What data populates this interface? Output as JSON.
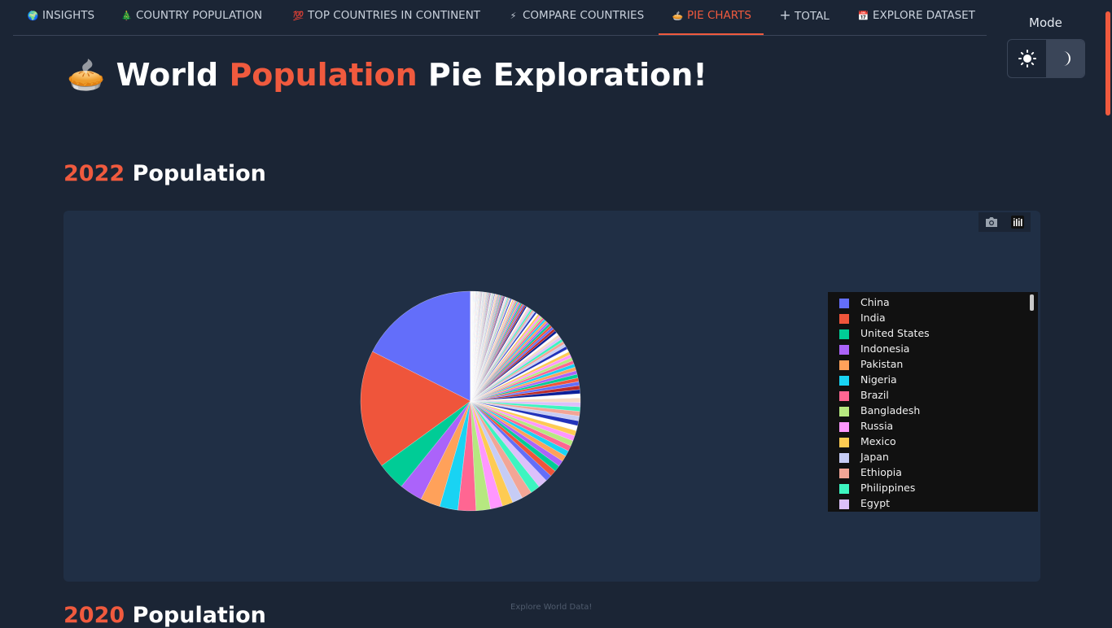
{
  "nav": {
    "tabs": [
      {
        "icon": "🌍",
        "label": "INSIGHTS"
      },
      {
        "icon": "🎄",
        "label": "COUNTRY POPULATION"
      },
      {
        "icon": "💯",
        "label": "TOP COUNTRIES IN CONTINENT"
      },
      {
        "icon": "⚡",
        "label": "COMPARE COUNTRIES"
      },
      {
        "icon": "🥧",
        "label": "PIE CHARTS"
      },
      {
        "icon": "+",
        "label": "TOTAL"
      },
      {
        "icon": "📅",
        "label": "EXPLORE DATASET"
      }
    ],
    "active_tab": "PIE CHARTS"
  },
  "mode": {
    "label": "Mode",
    "options": [
      "light-mode-sun-icon",
      "dark-mode-moon-icon"
    ],
    "selected": "dark"
  },
  "title": {
    "emoji": "🥧",
    "part1": "World",
    "accent": "Population",
    "part2": "Pie Exploration!"
  },
  "sections": [
    {
      "year": "2022",
      "label": "Population"
    },
    {
      "year": "2020",
      "label": "Population"
    }
  ],
  "footer": "Explore World Data!",
  "colors": {
    "accent": "#f05a3e",
    "background": "#1b2535",
    "card": "#202f45",
    "legend_bg": "#111111"
  },
  "chart_data": {
    "type": "pie",
    "title": "",
    "labels": [
      "China",
      "India",
      "United States",
      "Indonesia",
      "Pakistan",
      "Nigeria",
      "Brazil",
      "Bangladesh",
      "Russia",
      "Mexico",
      "Japan",
      "Ethiopia",
      "Philippines",
      "Egypt"
    ],
    "values": [
      1426,
      1417,
      338,
      276,
      236,
      218,
      215,
      171,
      145,
      128,
      124,
      123,
      116,
      111
    ],
    "colors": [
      "#636efa",
      "#ef553b",
      "#00cc96",
      "#ab63fa",
      "#ffa15a",
      "#19d3f3",
      "#ff6692",
      "#b6e880",
      "#ff97ff",
      "#fecb52",
      "#c6ccf5",
      "#f2a596",
      "#3df5c0",
      "#dcc0fb"
    ],
    "other_countries_total": 3076,
    "legend_position": "right",
    "sort": "descending",
    "direction": "clockwise",
    "start_angle": "12 o'clock"
  }
}
